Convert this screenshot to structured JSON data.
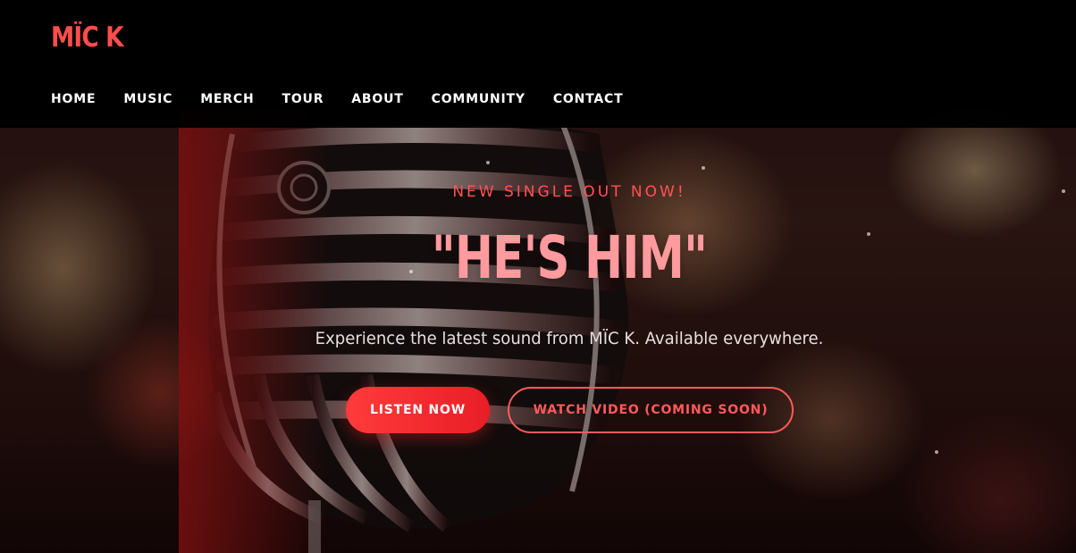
{
  "brand": {
    "logo_text": "MÏC K",
    "accent_color": "#ff4d4d"
  },
  "nav": {
    "items": [
      {
        "label": "HOME"
      },
      {
        "label": "MUSIC"
      },
      {
        "label": "MERCH"
      },
      {
        "label": "TOUR"
      },
      {
        "label": "ABOUT"
      },
      {
        "label": "COMMUNITY"
      },
      {
        "label": "CONTACT"
      }
    ]
  },
  "hero": {
    "eyebrow": "NEW SINGLE OUT NOW!",
    "title": "\"HE'S HIM\"",
    "subtitle": "Experience the latest sound from MÏC K. Available everywhere.",
    "background_icon": "vintage-microphone",
    "buttons": {
      "primary_label": "LISTEN NOW",
      "secondary_label": "WATCH VIDEO (COMING SOON)"
    },
    "colors": {
      "eyebrow": "#ff5252",
      "title": "#ff9a9e",
      "primary_button": "#ff3b3b"
    }
  }
}
